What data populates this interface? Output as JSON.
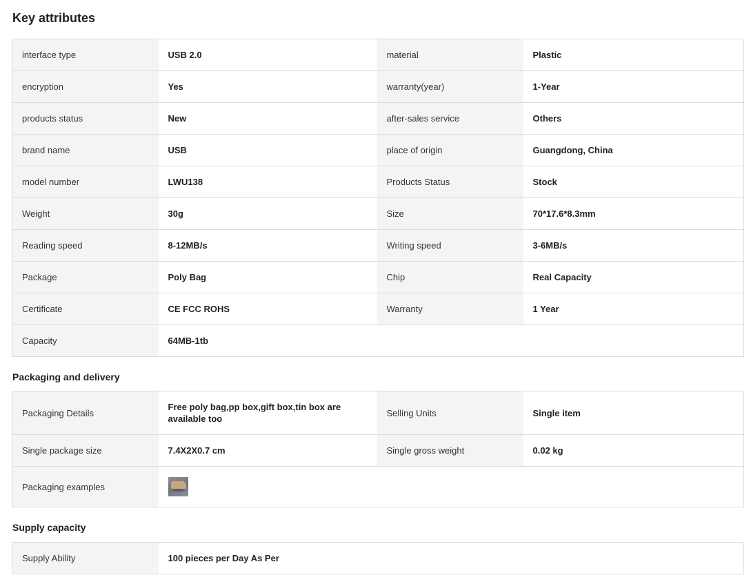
{
  "key_attributes": {
    "title": "Key attributes",
    "rows": [
      [
        "interface type",
        "USB 2.0",
        "material",
        "Plastic"
      ],
      [
        "encryption",
        "Yes",
        "warranty(year)",
        "1-Year"
      ],
      [
        "products status",
        "New",
        "after-sales service",
        "Others"
      ],
      [
        "brand name",
        "USB",
        "place of origin",
        "Guangdong, China"
      ],
      [
        "model number",
        "LWU138",
        "Products Status",
        "Stock"
      ],
      [
        "Weight",
        "30g",
        "Size",
        "70*17.6*8.3mm"
      ],
      [
        "Reading speed",
        "8-12MB/s",
        "Writing speed",
        "3-6MB/s"
      ],
      [
        "Package",
        "Poly Bag",
        "Chip",
        "Real Capacity"
      ],
      [
        "Certificate",
        "CE FCC ROHS",
        "Warranty",
        "1 Year"
      ],
      [
        "Capacity",
        "64MB-1tb"
      ]
    ]
  },
  "packaging": {
    "title": "Packaging and delivery",
    "rows": [
      [
        "Packaging Details",
        "Free poly bag,pp box,gift box,tin box are available too",
        "Selling Units",
        "Single item"
      ],
      [
        "Single package size",
        "7.4X2X0.7 cm",
        "Single gross weight",
        "0.02 kg"
      ],
      [
        "Packaging examples"
      ]
    ],
    "example_image_icon": "package-thumbnail-icon"
  },
  "supply": {
    "title": "Supply capacity",
    "rows": [
      [
        "Supply Ability",
        "100 pieces per Day As Per"
      ]
    ]
  },
  "colors": {
    "key_cell_bg": "#f4f4f4",
    "border": "#dddddd",
    "text": "#222222"
  }
}
